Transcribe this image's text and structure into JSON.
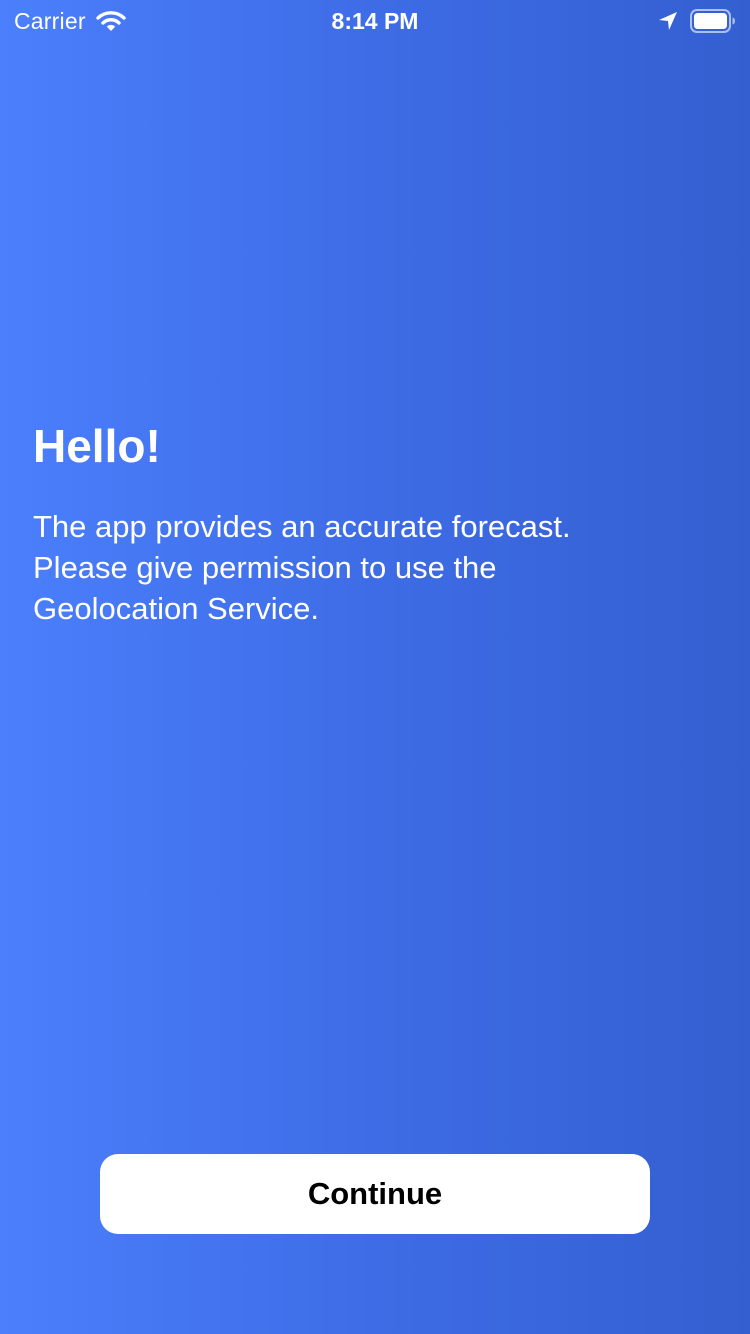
{
  "status_bar": {
    "carrier": "Carrier",
    "time": "8:14 PM",
    "icons": [
      "wifi-icon",
      "location-arrow-icon",
      "battery-icon"
    ]
  },
  "onboarding": {
    "title": "Hello!",
    "message_lines": [
      "The app provides an accurate forecast.",
      "Please give permission to use the",
      "Geolocation Service."
    ],
    "continue_label": "Continue"
  },
  "colors": {
    "background_start": "#4b7ffc",
    "background_end": "#335fd0",
    "text": "#ffffff",
    "button_background": "#ffffff",
    "button_text": "#000000"
  }
}
